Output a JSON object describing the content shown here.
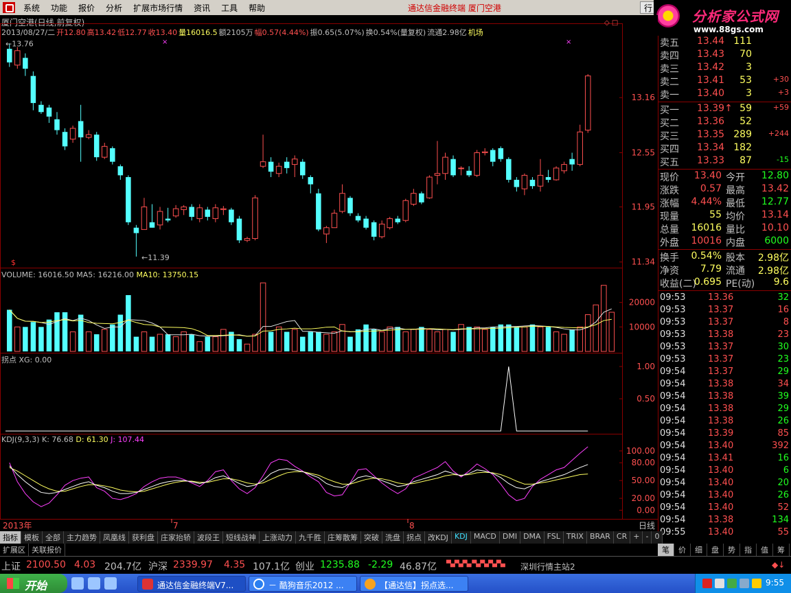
{
  "menu": {
    "items": [
      "系统",
      "功能",
      "报价",
      "分析",
      "扩展市场行情",
      "资讯",
      "工具",
      "帮助"
    ],
    "center_title": "通达信金融终端    厦门空港",
    "right_tab": "行"
  },
  "brand": {
    "title": "分析家公式网",
    "url": "www.88gs.com"
  },
  "info": {
    "line1": "厦门空港(日线,前复权)",
    "line2": [
      {
        "text": "2013/08/27/二",
        "color": "#c0c0c0"
      },
      {
        "text": "开12.80",
        "color": "#ff5050"
      },
      {
        "text": "高13.42",
        "color": "#ff5050"
      },
      {
        "text": "低12.77",
        "color": "#ff5050"
      },
      {
        "text": "收13.40",
        "color": "#ff5050"
      },
      {
        "text": "量16016.5",
        "color": "#ffff60"
      },
      {
        "text": "额2105万",
        "color": "#c0c0c0"
      },
      {
        "text": "幅0.57(4.44%)",
        "color": "#ff5050"
      },
      {
        "text": "振0.65(5.07%)",
        "color": "#c0c0c0"
      },
      {
        "text": "换0.54%(量复权)",
        "color": "#c0c0c0"
      },
      {
        "text": "流通2.98亿",
        "color": "#c0c0c0"
      },
      {
        "text": "机场",
        "color": "#ffff60"
      }
    ]
  },
  "price_axis": [
    "13.16",
    "12.55",
    "11.95",
    "11.34"
  ],
  "price_marks": {
    "high": "13.76",
    "low": "11.39"
  },
  "volume": {
    "label": "VOLUME: 16016.50",
    "ma5": "MA5: 16216.00",
    "ma10": "MA10: 13750.15",
    "axis": [
      "20000",
      "10000"
    ]
  },
  "xg": {
    "label": "拐点  XG: 0.00",
    "axis": [
      "1.00",
      "0.50"
    ]
  },
  "kdj": {
    "label": "KDJ(9,3,3)",
    "k": "K: 76.68",
    "d": "D: 61.30",
    "j": "J: 107.44",
    "axis": [
      "100.00",
      "80.00",
      "50.00",
      "20.00",
      "0.00"
    ]
  },
  "dates": {
    "year": "2013年",
    "m7": "7",
    "m8": "8",
    "period": "日线"
  },
  "chart_data": {
    "type": "candlestick",
    "candles": [
      [
        13.7,
        13.55,
        13.76,
        13.5,
        1
      ],
      [
        13.52,
        13.68,
        13.72,
        13.48,
        0
      ],
      [
        13.6,
        13.48,
        13.65,
        13.4,
        1
      ],
      [
        13.4,
        13.1,
        13.45,
        13.02,
        1
      ],
      [
        13.08,
        13.0,
        13.12,
        12.98,
        0
      ],
      [
        13.05,
        12.95,
        13.08,
        12.88,
        1
      ],
      [
        12.92,
        12.8,
        13.0,
        12.75,
        1
      ],
      [
        12.78,
        12.62,
        12.82,
        12.58,
        1
      ],
      [
        12.7,
        12.82,
        12.85,
        12.66,
        0
      ],
      [
        12.9,
        12.72,
        13.08,
        12.45,
        1
      ],
      [
        12.72,
        12.75,
        12.8,
        12.7,
        0
      ],
      [
        12.75,
        12.5,
        12.78,
        12.46,
        0
      ],
      [
        12.5,
        12.62,
        12.66,
        12.48,
        0
      ],
      [
        12.6,
        12.45,
        12.62,
        12.42,
        1
      ],
      [
        12.4,
        12.3,
        12.42,
        12.25,
        1
      ],
      [
        12.28,
        11.78,
        12.3,
        11.75,
        1
      ],
      [
        11.72,
        11.66,
        11.75,
        11.4,
        1
      ],
      [
        11.7,
        11.95,
        12.05,
        11.7,
        0
      ],
      [
        11.78,
        11.72,
        11.98,
        11.72,
        0
      ],
      [
        11.75,
        11.9,
        11.95,
        11.7,
        0
      ],
      [
        11.82,
        11.8,
        11.94,
        11.78,
        1
      ],
      [
        11.85,
        11.93,
        11.97,
        11.83,
        0
      ],
      [
        11.92,
        11.95,
        11.97,
        11.86,
        0
      ],
      [
        11.95,
        11.84,
        11.98,
        11.8,
        1
      ],
      [
        11.82,
        11.94,
        11.98,
        11.78,
        0
      ],
      [
        11.92,
        11.84,
        11.95,
        11.8,
        1
      ],
      [
        11.82,
        11.94,
        11.98,
        11.78,
        0
      ],
      [
        11.92,
        11.93,
        11.96,
        11.86,
        0
      ],
      [
        11.92,
        11.78,
        11.94,
        11.75,
        1
      ],
      [
        11.82,
        11.58,
        11.85,
        11.55,
        1
      ],
      [
        11.58,
        11.6,
        11.62,
        11.56,
        0
      ],
      [
        11.6,
        12.05,
        12.08,
        11.58,
        0
      ],
      [
        12.4,
        12.45,
        12.75,
        12.38,
        0
      ],
      [
        12.45,
        12.34,
        12.5,
        12.28,
        1
      ],
      [
        12.32,
        12.4,
        12.44,
        12.28,
        0
      ],
      [
        12.45,
        12.38,
        12.5,
        12.32,
        1
      ],
      [
        12.42,
        12.48,
        12.52,
        12.28,
        0
      ],
      [
        12.45,
        12.3,
        12.48,
        12.26,
        1
      ],
      [
        12.28,
        12.2,
        12.3,
        12.1,
        1
      ],
      [
        12.1,
        11.7,
        12.15,
        11.68,
        1
      ],
      [
        11.65,
        11.72,
        11.74,
        11.55,
        0
      ],
      [
        11.72,
        11.88,
        11.92,
        11.72,
        0
      ],
      [
        11.9,
        12.1,
        12.2,
        11.88,
        0
      ],
      [
        12.05,
        11.88,
        12.07,
        11.85,
        1
      ],
      [
        11.85,
        11.8,
        11.88,
        11.78,
        1
      ],
      [
        11.82,
        11.72,
        11.85,
        11.7,
        1
      ],
      [
        11.78,
        11.62,
        11.8,
        11.58,
        1
      ],
      [
        11.62,
        11.76,
        11.8,
        11.6,
        0
      ],
      [
        11.72,
        11.82,
        11.84,
        11.7,
        0
      ],
      [
        11.82,
        11.78,
        11.85,
        11.76,
        1
      ],
      [
        11.8,
        12.02,
        12.04,
        11.78,
        0
      ],
      [
        11.98,
        12.1,
        12.15,
        11.96,
        0
      ],
      [
        12.1,
        12.0,
        12.12,
        11.98,
        1
      ],
      [
        12.05,
        12.28,
        12.3,
        12.04,
        0
      ],
      [
        12.3,
        12.32,
        12.68,
        12.2,
        0
      ],
      [
        12.32,
        12.5,
        12.55,
        12.25,
        0
      ],
      [
        12.48,
        12.3,
        12.52,
        12.28,
        1
      ],
      [
        12.38,
        12.38,
        12.4,
        12.3,
        0
      ],
      [
        12.35,
        12.3,
        12.4,
        12.28,
        1
      ],
      [
        12.3,
        12.55,
        12.58,
        12.28,
        0
      ],
      [
        12.55,
        12.56,
        12.6,
        12.52,
        0
      ],
      [
        12.58,
        12.45,
        12.6,
        12.4,
        0
      ],
      [
        12.6,
        12.48,
        12.62,
        12.45,
        1
      ],
      [
        12.48,
        12.25,
        12.5,
        12.22,
        1
      ],
      [
        12.25,
        12.17,
        12.28,
        12.12,
        1
      ],
      [
        12.15,
        12.3,
        12.32,
        12.08,
        0
      ],
      [
        12.25,
        12.18,
        12.28,
        12.15,
        1
      ],
      [
        12.18,
        12.3,
        12.48,
        12.12,
        0
      ],
      [
        12.28,
        12.25,
        12.36,
        12.22,
        1
      ],
      [
        12.25,
        12.38,
        12.4,
        12.24,
        0
      ],
      [
        12.35,
        12.42,
        12.45,
        12.32,
        0
      ],
      [
        12.42,
        12.48,
        12.55,
        12.35,
        1
      ],
      [
        12.42,
        12.78,
        12.86,
        12.4,
        0
      ],
      [
        12.8,
        13.4,
        13.42,
        12.77,
        0
      ]
    ],
    "volume": [
      17,
      10,
      10,
      12,
      10,
      13,
      16,
      16,
      8,
      15,
      8,
      7,
      9,
      11,
      15,
      23,
      6,
      8,
      6,
      7,
      7,
      6,
      8,
      7,
      4,
      6,
      6,
      9,
      8,
      5,
      3,
      7,
      28,
      8,
      10,
      8,
      9,
      6,
      8,
      8,
      7,
      8,
      11,
      6,
      9,
      11,
      9,
      8,
      10,
      10,
      8,
      9,
      10,
      9,
      8,
      9,
      8,
      11,
      10,
      10,
      9,
      10,
      11,
      11,
      10,
      10,
      11,
      10,
      10,
      8,
      7,
      9,
      10,
      15,
      19,
      27,
      16
    ],
    "kdj_k": [
      75,
      60,
      48,
      38,
      30,
      28,
      30,
      35,
      40,
      45,
      48,
      42,
      38,
      32,
      28,
      28,
      30,
      35,
      40,
      45,
      48,
      50,
      50,
      48,
      45,
      48,
      55,
      58,
      52,
      45,
      40,
      42,
      50,
      62,
      68,
      70,
      68,
      65,
      60,
      55,
      45,
      40,
      38,
      45,
      55,
      58,
      55,
      50,
      45,
      40,
      42,
      48,
      52,
      56,
      60,
      66,
      62,
      58,
      62,
      68,
      66,
      62,
      55,
      45,
      38,
      36,
      42,
      48,
      52,
      56,
      60,
      66,
      72,
      77
    ],
    "kdj_d": [
      72,
      66,
      58,
      50,
      42,
      36,
      32,
      32,
      36,
      40,
      43,
      43,
      41,
      38,
      34,
      32,
      31,
      32,
      36,
      40,
      44,
      47,
      49,
      49,
      47,
      47,
      50,
      53,
      53,
      50,
      46,
      44,
      46,
      52,
      58,
      63,
      65,
      65,
      62,
      59,
      53,
      48,
      44,
      44,
      48,
      52,
      54,
      53,
      50,
      46,
      44,
      45,
      48,
      51,
      54,
      58,
      60,
      59,
      60,
      63,
      64,
      63,
      60,
      55,
      49,
      44,
      44,
      46,
      48,
      51,
      54,
      57,
      60,
      61
    ],
    "kdj_j": [
      80,
      48,
      28,
      14,
      6,
      12,
      26,
      42,
      50,
      54,
      56,
      38,
      32,
      20,
      18,
      22,
      28,
      40,
      48,
      54,
      56,
      56,
      52,
      46,
      40,
      50,
      65,
      68,
      50,
      36,
      28,
      38,
      58,
      80,
      86,
      84,
      74,
      66,
      56,
      48,
      30,
      24,
      26,
      46,
      68,
      70,
      58,
      46,
      36,
      28,
      36,
      54,
      60,
      66,
      72,
      82,
      66,
      56,
      66,
      78,
      70,
      60,
      44,
      26,
      16,
      20,
      40,
      52,
      60,
      68,
      72,
      84,
      96,
      107
    ],
    "xg_spike_index": 63
  },
  "quote": {
    "sell": [
      {
        "label": "卖五",
        "price": "13.44",
        "vol": "111",
        "chg": ""
      },
      {
        "label": "卖四",
        "price": "13.43",
        "vol": "70",
        "chg": ""
      },
      {
        "label": "卖三",
        "price": "13.42",
        "vol": "3",
        "chg": ""
      },
      {
        "label": "卖二",
        "price": "13.41",
        "vol": "53",
        "chg": "+30"
      },
      {
        "label": "卖一",
        "price": "13.40",
        "vol": "3",
        "chg": "+3"
      }
    ],
    "buy": [
      {
        "label": "买一",
        "price": "13.39↑",
        "vol": "59",
        "chg": "+59"
      },
      {
        "label": "买二",
        "price": "13.36",
        "vol": "52",
        "chg": ""
      },
      {
        "label": "买三",
        "price": "13.35",
        "vol": "289",
        "chg": "+244"
      },
      {
        "label": "买四",
        "price": "13.34",
        "vol": "182",
        "chg": ""
      },
      {
        "label": "买五",
        "price": "13.33",
        "vol": "87",
        "chg": "-15"
      }
    ],
    "stats": [
      {
        "l1": "现价",
        "v1": "13.40",
        "c1": "#ff5050",
        "l2": "今开",
        "v2": "12.80",
        "c2": "#20ff20"
      },
      {
        "l1": "涨跌",
        "v1": "0.57",
        "c1": "#ff5050",
        "l2": "最高",
        "v2": "13.42",
        "c2": "#ff5050"
      },
      {
        "l1": "涨幅",
        "v1": "4.44%",
        "c1": "#ff5050",
        "l2": "最低",
        "v2": "12.77",
        "c2": "#20ff20"
      },
      {
        "l1": "现量",
        "v1": "55",
        "c1": "#ffff60",
        "l2": "均价",
        "v2": "13.14",
        "c2": "#ff5050"
      },
      {
        "l1": "总量",
        "v1": "16016",
        "c1": "#ffff60",
        "l2": "量比",
        "v2": "10.10",
        "c2": "#ff5050"
      },
      {
        "l1": "外盘",
        "v1": "10016",
        "c1": "#ff5050",
        "l2": "内盘",
        "v2": "6000",
        "c2": "#20ff20"
      },
      {
        "l1": "换手",
        "v1": "0.54%",
        "c1": "#ffff60",
        "l2": "股本",
        "v2": "2.98亿",
        "c2": "#ffff60"
      },
      {
        "l1": "净资",
        "v1": "7.79",
        "c1": "#ffff60",
        "l2": "流通",
        "v2": "2.98亿",
        "c2": "#ffff60"
      },
      {
        "l1": "收益(二)",
        "v1": "0.695",
        "c1": "#ffff60",
        "l2": "PE(动)",
        "v2": "9.6",
        "c2": "#ffff60"
      }
    ],
    "ticks": [
      {
        "t": "09:53",
        "p": "13.36",
        "pc": "#ff5050",
        "v": "32",
        "vc": "#20ff20"
      },
      {
        "t": "09:53",
        "p": "13.37",
        "pc": "#ff5050",
        "v": "16",
        "vc": "#ff5050"
      },
      {
        "t": "09:53",
        "p": "13.37",
        "pc": "#ff5050",
        "v": "8",
        "vc": "#ff5050"
      },
      {
        "t": "09:53",
        "p": "13.38",
        "pc": "#ff5050",
        "v": "23",
        "vc": "#ff5050"
      },
      {
        "t": "09:53",
        "p": "13.37",
        "pc": "#ff5050",
        "v": "30",
        "vc": "#20ff20"
      },
      {
        "t": "09:53",
        "p": "13.37",
        "pc": "#ff5050",
        "v": "23",
        "vc": "#20ff20"
      },
      {
        "t": "09:54",
        "p": "13.37",
        "pc": "#ff5050",
        "v": "29",
        "vc": "#20ff20"
      },
      {
        "t": "09:54",
        "p": "13.38",
        "pc": "#ff5050",
        "v": "34",
        "vc": "#ff5050"
      },
      {
        "t": "09:54",
        "p": "13.38",
        "pc": "#ff5050",
        "v": "39",
        "vc": "#20ff20"
      },
      {
        "t": "09:54",
        "p": "13.38",
        "pc": "#ff5050",
        "v": "29",
        "vc": "#20ff20"
      },
      {
        "t": "09:54",
        "p": "13.38",
        "pc": "#ff5050",
        "v": "26",
        "vc": "#20ff20"
      },
      {
        "t": "09:54",
        "p": "13.39",
        "pc": "#ff5050",
        "v": "85",
        "vc": "#ff5050"
      },
      {
        "t": "09:54",
        "p": "13.40",
        "pc": "#ff5050",
        "v": "392",
        "vc": "#ff5050"
      },
      {
        "t": "09:54",
        "p": "13.41",
        "pc": "#ff5050",
        "v": "16",
        "vc": "#20ff20"
      },
      {
        "t": "09:54",
        "p": "13.40",
        "pc": "#ff5050",
        "v": "6",
        "vc": "#20ff20"
      },
      {
        "t": "09:54",
        "p": "13.40",
        "pc": "#ff5050",
        "v": "20",
        "vc": "#20ff20"
      },
      {
        "t": "09:54",
        "p": "13.40",
        "pc": "#ff5050",
        "v": "26",
        "vc": "#20ff20"
      },
      {
        "t": "09:54",
        "p": "13.40",
        "pc": "#ff5050",
        "v": "52",
        "vc": "#ff5050"
      },
      {
        "t": "09:54",
        "p": "13.38",
        "pc": "#ff5050",
        "v": "134",
        "vc": "#20ff20"
      },
      {
        "t": "09:55",
        "p": "13.40",
        "pc": "#ff5050",
        "v": "55",
        "vc": "#ff5050"
      }
    ]
  },
  "tabs": [
    "指标",
    "模板",
    "全部",
    "主力趋势",
    "凤凰线",
    "获利盘",
    "庄家抬轿",
    "波段王",
    "短线战神",
    "上涨动力",
    "九千胜",
    "庄筹散筹",
    "突破",
    "洗盘",
    "拐点",
    "改KDJ",
    "KDJ",
    "MACD",
    "DMI",
    "DMA",
    "FSL",
    "TRIX",
    "BRAR",
    "CR",
    "+",
    "-",
    "0"
  ],
  "tabs2": [
    "扩展区",
    "关联报价"
  ],
  "rtabs": [
    "笔",
    "价",
    "细",
    "盘",
    "势",
    "指",
    "值",
    "筹"
  ],
  "status": [
    {
      "text": "上证",
      "color": "#c0c0c0"
    },
    {
      "text": "2100.50",
      "color": "#ff5050"
    },
    {
      "text": "4.03",
      "color": "#ff5050"
    },
    {
      "text": "204.7亿",
      "color": "#c0c0c0"
    },
    {
      "text": "沪深",
      "color": "#c0c0c0"
    },
    {
      "text": "2339.97",
      "color": "#ff5050"
    },
    {
      "text": "4.35",
      "color": "#ff5050"
    },
    {
      "text": "107.1亿",
      "color": "#c0c0c0"
    },
    {
      "text": "创业",
      "color": "#c0c0c0"
    },
    {
      "text": "1235.88",
      "color": "#20ff20"
    },
    {
      "text": "-2.29",
      "color": "#20ff20"
    },
    {
      "text": "46.87亿",
      "color": "#c0c0c0"
    },
    {
      "text": "深圳行情主站2",
      "color": "#c0c0c0"
    }
  ],
  "taskbar": {
    "start": "开始",
    "items": [
      "通达信金融终端V7...",
      "－ 酷狗音乐2012 ...",
      "【通达信】拐点选..."
    ],
    "clock": "9:55"
  }
}
